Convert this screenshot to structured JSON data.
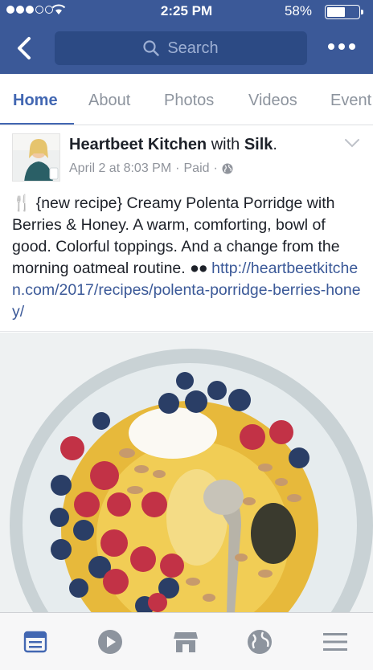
{
  "status_bar": {
    "time": "2:25 PM",
    "battery_percent": "58%",
    "battery_level": 0.58,
    "signal_filled": 3,
    "signal_total": 5
  },
  "nav": {
    "back_icon": "chevron-left-icon",
    "search_placeholder": "Search",
    "more_icon": "more-dots-icon"
  },
  "tabs": [
    {
      "label": "Home",
      "active": true
    },
    {
      "label": "About",
      "active": false
    },
    {
      "label": "Photos",
      "active": false
    },
    {
      "label": "Videos",
      "active": false
    },
    {
      "label": "Event",
      "active": false
    }
  ],
  "post": {
    "page_name": "Heartbeet Kitchen",
    "with_word": " with ",
    "partner": "Silk",
    "period": ".",
    "date": "April 2 at 8:03 PM",
    "separator": "·",
    "paid": "Paid",
    "privacy_icon": "globe-icon",
    "text_body": " {new recipe} Creamy Polenta Porridge with Berries & Honey. A warm, comforting, bowl of good. Colorful toppings. And a change from the morning oatmeal routine. ",
    "emoji_prefix": "🍴",
    "emoji_dots": "●●",
    "link": "http://heartbeetkitchen.com/2017/recipes/polenta-porridge-berries-honey/"
  },
  "bottom_bar": [
    {
      "icon": "news-feed-icon",
      "active": true
    },
    {
      "icon": "video-play-icon",
      "active": false
    },
    {
      "icon": "marketplace-icon",
      "active": false
    },
    {
      "icon": "globe-icon",
      "active": false
    },
    {
      "icon": "menu-icon",
      "active": false
    }
  ],
  "colors": {
    "brand": "#3b5998",
    "active_tab": "#4267b2",
    "muted": "#90949c"
  }
}
